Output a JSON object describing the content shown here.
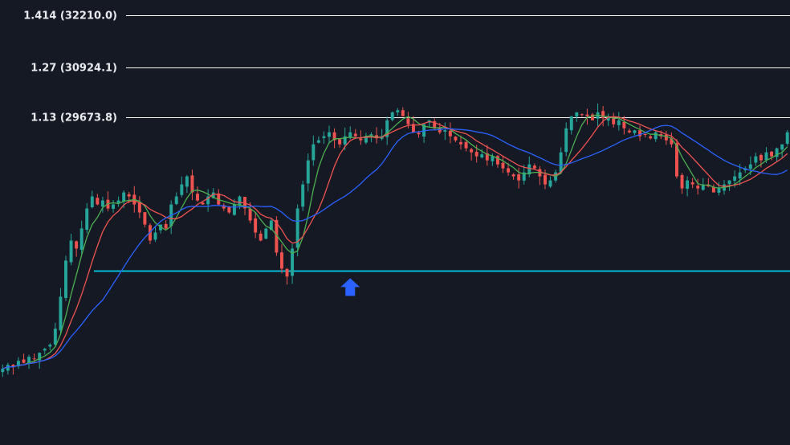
{
  "chart_data": {
    "type": "candlestick",
    "title": "",
    "xlabel": "",
    "ylabel": "",
    "grid": false,
    "ylim": [
      21500,
      32600
    ],
    "fib_levels": [
      {
        "ratio": "1.414",
        "price": 32210.0,
        "label": "1.414 (32210.0)"
      },
      {
        "ratio": "1.27",
        "price": 30924.1,
        "label": "1.27 (30924.1)"
      },
      {
        "ratio": "1.13",
        "price": 29673.8,
        "label": "1.13 (29673.8)"
      }
    ],
    "horizontal_line": {
      "price": 25840,
      "color": "#00bcd4"
    },
    "buy_marker": {
      "index": 66,
      "price": 25500,
      "color": "#2962ff"
    },
    "colors": {
      "up": "#26a69a",
      "down": "#ef5350",
      "background": "#151924",
      "fib_line": "#ffffff"
    },
    "moving_averages": [
      {
        "period": 5,
        "color": "#4caf50"
      },
      {
        "period": 9,
        "color": "#ef5350"
      },
      {
        "period": 20,
        "color": "#2962ff"
      }
    ],
    "closes": [
      23400,
      23500,
      23450,
      23600,
      23550,
      23700,
      23650,
      23800,
      23900,
      24000,
      24400,
      25200,
      26100,
      26600,
      26400,
      26900,
      27400,
      27700,
      27500,
      27600,
      27400,
      27500,
      27600,
      27800,
      27700,
      27500,
      27300,
      27000,
      26600,
      26800,
      27000,
      26900,
      27500,
      27700,
      28000,
      28200,
      27800,
      27600,
      27500,
      27700,
      27800,
      27500,
      27400,
      27300,
      27500,
      27700,
      27400,
      27100,
      26800,
      26600,
      26900,
      27100,
      26300,
      25900,
      25700,
      26400,
      27400,
      28000,
      28600,
      29000,
      29100,
      29200,
      29300,
      29100,
      29000,
      29200,
      29300,
      29200,
      29100,
      29200,
      29250,
      29150,
      29200,
      29600,
      29800,
      29850,
      29700,
      29500,
      29300,
      29250,
      29500,
      29600,
      29400,
      29300,
      29350,
      29200,
      29100,
      29000,
      28900,
      28800,
      28700,
      28750,
      28600,
      28700,
      28500,
      28400,
      28300,
      28200,
      28100,
      28300,
      28500,
      28400,
      28200,
      28000,
      28100,
      28300,
      28800,
      29400,
      29700,
      29800,
      29750,
      29700,
      29600,
      29800,
      29650,
      29700,
      29500,
      29600,
      29400,
      29300,
      29350,
      29200,
      29250,
      29150,
      29300,
      29200,
      29100,
      29000,
      28200,
      27900,
      28100,
      28000,
      27900,
      28000,
      27950,
      27800,
      27900,
      28000,
      28100,
      28200,
      28300,
      28400,
      28500,
      28700,
      28600,
      28800,
      28700,
      28900,
      29000,
      29300
    ]
  }
}
